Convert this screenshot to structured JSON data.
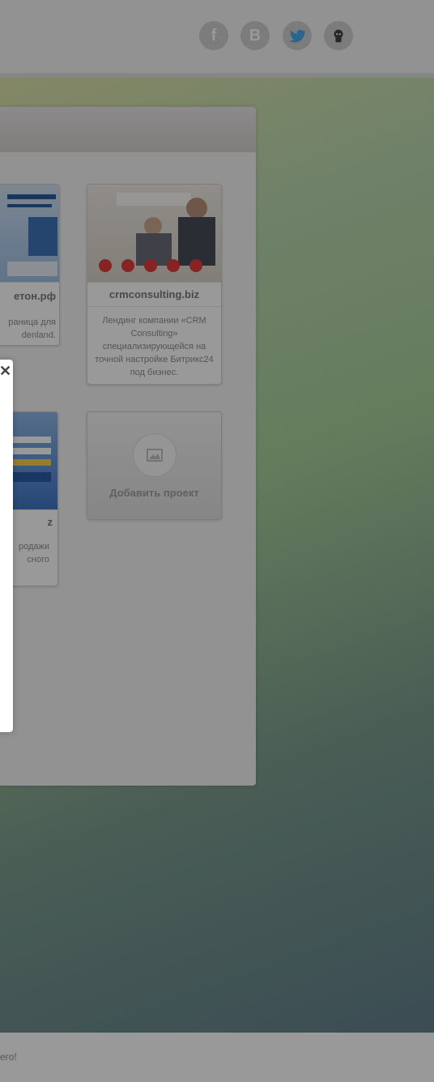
{
  "header": {
    "social": [
      {
        "name": "facebook",
        "glyph": "f"
      },
      {
        "name": "vkontakte",
        "glyph": "B"
      },
      {
        "name": "twitter",
        "glyph": ""
      },
      {
        "name": "github",
        "glyph": ""
      }
    ]
  },
  "projects": [
    {
      "title": "етон.рф",
      "description": "раница для\ndenland."
    },
    {
      "title": "crmconsulting.biz",
      "description": "Лендинг компании «CRM Consulting» специализирующейся на точной настройке Битрикс24 под бизнес."
    },
    {
      "title": "z",
      "description": "родажи\nсного"
    }
  ],
  "add_project": {
    "label": "Добавить проект"
  },
  "modal": {
    "close_glyph": "✕"
  },
  "footer": {
    "text": "его!"
  },
  "colors": {
    "overlay": "rgba(0,0,0,0.4)",
    "topbar": "#f4f4f4",
    "panel": "#f4f4f4"
  }
}
